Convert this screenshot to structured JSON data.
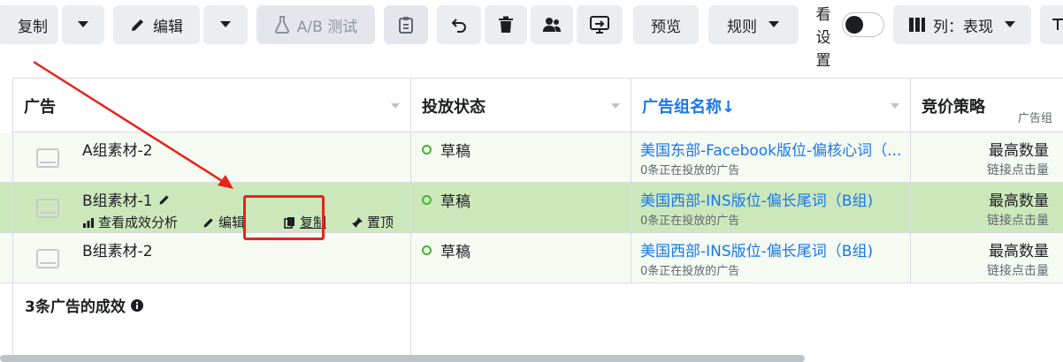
{
  "toolbar": {
    "copy_label": "复制",
    "edit_label": "编辑",
    "ab_test_label": "A/B 测试",
    "preview_label": "预览",
    "rules_label": "规则",
    "toggle_label": "看设置",
    "columns_label": "列：表现"
  },
  "table": {
    "headers": {
      "ad": "广告",
      "status": "投放状态",
      "adset": "广告组名称↓",
      "bid": "竞价策略",
      "bid_sub": "广告组"
    },
    "rows": [
      {
        "name": "A组素材-2",
        "status": "草稿",
        "adset": "美国东部-Facebook版位-偏核心词（...",
        "adset_sub": "0条正在投放的广告",
        "bid": "最高数量",
        "bid_sub": "链接点击量"
      },
      {
        "name": "B组素材-1",
        "status": "草稿",
        "adset": "美国西部-INS版位-偏长尾词（B组)",
        "adset_sub": "0条正在投放的广告",
        "bid": "最高数量",
        "bid_sub": "链接点击量",
        "actions": {
          "insights": "查看成效分析",
          "edit": "编辑",
          "duplicate": "复制",
          "pin": "置顶"
        }
      },
      {
        "name": "B组素材-2",
        "status": "草稿",
        "adset": "美国西部-INS版位-偏长尾词（B组)",
        "adset_sub": "0条正在投放的广告",
        "bid": "最高数量",
        "bid_sub": "链接点击量"
      }
    ],
    "summary": "3条广告的成效"
  },
  "colors": {
    "accent": "#1877f2",
    "selected_row": "#cce8bb",
    "draft_status": "#42b72a",
    "annotation_red": "#e8231a"
  },
  "icons": {
    "edit": "pencil-icon",
    "ab_test": "flask-icon",
    "clipboard": "clipboard-icon",
    "undo": "undo-icon",
    "delete": "trash-icon",
    "audience": "people-icon",
    "export": "export-icon",
    "columns": "columns-icon",
    "info": "info-icon"
  }
}
